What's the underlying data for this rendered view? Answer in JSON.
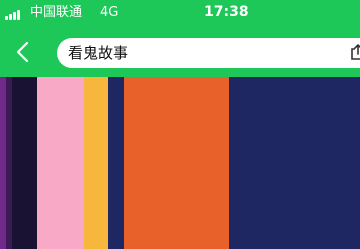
{
  "status_bar": {
    "carrier": "中国联通",
    "network": "4G",
    "time": "17:38",
    "signal_icon": "signal-bars-icon"
  },
  "nav": {
    "back_icon": "chevron-left-icon",
    "title": "看鬼故事",
    "share_icon": "share-icon"
  },
  "colors": {
    "accent": "#1dc858",
    "stripes": [
      "#6f2a8a",
      "#1a1233",
      "#f7a9c6",
      "#f6b73c",
      "#1f2762",
      "#e8612a",
      "#1f2762"
    ]
  }
}
